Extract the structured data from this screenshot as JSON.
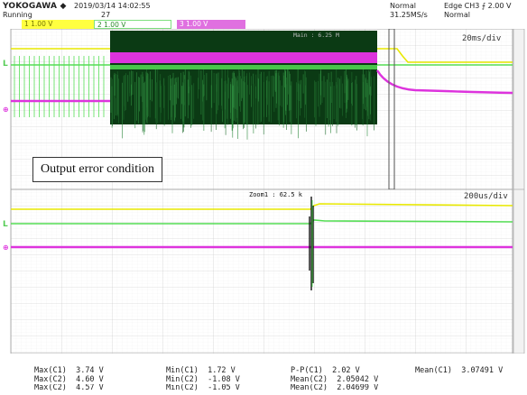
{
  "header": {
    "brand": "YOKOGAWA ◆",
    "status": "Running",
    "datetime": "2019/03/14 14:02:55",
    "acq_count": "27",
    "ch1_label": "1  1.00 V",
    "ch2_label": "2  1.00 V",
    "ch3_label": "3  1.00 V",
    "mode": "Normal",
    "sample_rate": "31.25MS/s",
    "trigger": "Edge CH3 ⨍ 2.00 V",
    "trigger_mode": "Normal"
  },
  "main_window": {
    "timebase": "20ms/div",
    "main_info": "Main : 6.25 M"
  },
  "zoom_window": {
    "timebase": "200us/div",
    "zoom_label": "Zoom1 : 62.5 k"
  },
  "callout": "Output error condition",
  "markers": {
    "level_marker": "L",
    "ground_marker": "⊕"
  },
  "colors": {
    "ch1": "#e8e800",
    "ch2": "#55dd55",
    "ch3": "#dd33dd",
    "grid": "#bdbdbd",
    "burst": "#0b3a14"
  },
  "measurements": [
    [
      {
        "label": "Max(C1)",
        "value": "3.74 V"
      },
      {
        "label": "Min(C1)",
        "value": "1.72 V"
      },
      {
        "label": "P-P(C1)",
        "value": "2.02 V"
      },
      {
        "label": "Mean(C1)",
        "value": "3.07491 V"
      }
    ],
    [
      {
        "label": "Max(C2)",
        "value": "4.60 V"
      },
      {
        "label": "Min(C2)",
        "value": "-1.08 V"
      },
      {
        "label": "Mean(C2)",
        "value": "2.05042 V"
      }
    ],
    [
      {
        "label": "Max(C2)",
        "value": "4.57 V"
      },
      {
        "label": "Min(C2)",
        "value": "-1.05 V"
      },
      {
        "label": "Mean(C2)",
        "value": "2.04699 V"
      }
    ]
  ]
}
